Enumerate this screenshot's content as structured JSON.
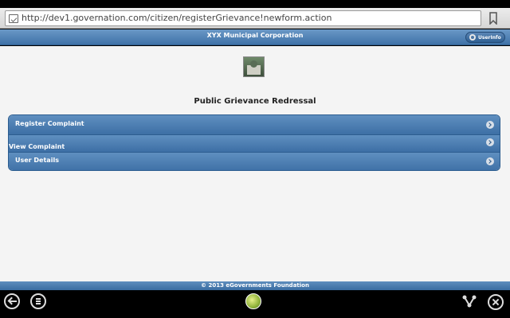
{
  "browser": {
    "url": "http://dev1.governation.com/citizen/registerGrievance!newform.action"
  },
  "header": {
    "title": "XYX Municipal Corporation",
    "userinfo_label": "UserInfo"
  },
  "main": {
    "page_title": "Public Grievance Redressal",
    "menu_items": [
      {
        "label": "Register Complaint"
      },
      {
        "label": "View Complaint"
      },
      {
        "label": "User Details"
      }
    ]
  },
  "footer": {
    "text": "© 2013 eGovernments Foundation"
  },
  "colors": {
    "header_blue": "#4a7cb0",
    "content_bg": "#f4f4f4"
  }
}
